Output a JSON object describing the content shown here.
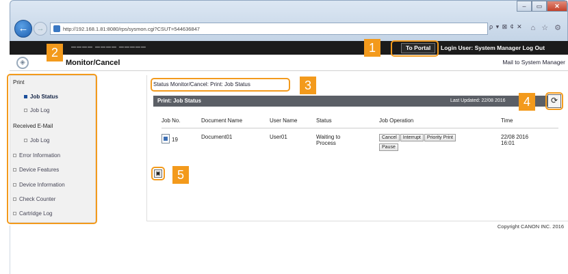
{
  "browser": {
    "address": "http://192.168.1.81:8080/rps/sysmon.cgi?CSUT=544636847",
    "window_buttons": [
      "–",
      "▭",
      "✕"
    ],
    "search_tools": "ρ ▾ ⊠ ¢ ✕",
    "home_icons": "⌂ ☆ ⚙"
  },
  "topbar": {
    "portal_button": "To Portal",
    "login_text": "Login User: System Manager Log Out"
  },
  "header": {
    "title": "Monitor/Cancel",
    "mail_link": "Mail to System Manager"
  },
  "sidebar": {
    "print_section": "Print",
    "job_status": "Job Status",
    "job_log": "Job Log",
    "received_section": "Received E-Mail",
    "received_job_log": "Job Log",
    "error_info": "Error Information",
    "device_features": "Device Features",
    "device_info": "Device Information",
    "check_counter": "Check Counter",
    "cartridge_log": "Cartridge Log"
  },
  "main": {
    "breadcrumb": "Status Monitor/Cancel: Print: Job Status",
    "panel_title": "Print: Job Status",
    "last_updated": "Last Updated: 22/08 2016",
    "columns": [
      "Job No.",
      "Document Name",
      "User Name",
      "Status",
      "Job Operation",
      "Time"
    ],
    "row": {
      "job_no": "19",
      "document": "Document01",
      "user": "User01",
      "status_line1": "Waiting to",
      "status_line2": "Process",
      "time_line1": "22/08 2016",
      "time_line2": "16:01"
    },
    "operations": [
      "Cancel",
      "Interrupt",
      "Priority Print",
      "Pause"
    ]
  },
  "footer": {
    "copyright": "Copyright CANON INC. 2016"
  },
  "callouts": [
    "1",
    "2",
    "3",
    "4",
    "5"
  ],
  "colors": {
    "callout": "#f39a1c",
    "panel_header": "#5b5f66",
    "top_bar": "#1b1b1b"
  }
}
